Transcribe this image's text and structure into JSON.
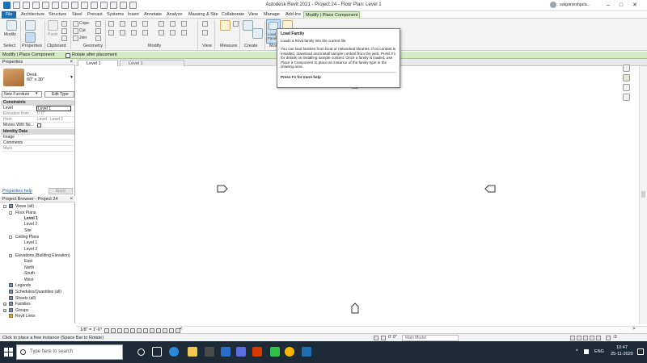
{
  "title_bar": {
    "app_title": "Autodesk Revit 2021 - Project 24 - Floor Plan: Level 1",
    "user": "saiganeshjala...",
    "window_buttons": [
      "minimize",
      "maximize",
      "close"
    ]
  },
  "menu_tabs": [
    "File",
    "Architecture",
    "Structure",
    "Steel",
    "Precast",
    "Systems",
    "Insert",
    "Annotate",
    "Analyze",
    "Massing & Site",
    "Collaborate",
    "View",
    "Manage",
    "Add-Ins",
    "Modify | Place Component"
  ],
  "ribbon": {
    "select": {
      "modify": "Modify",
      "group": "Select"
    },
    "properties": {
      "group": "Properties"
    },
    "clipboard": {
      "paste": "Paste",
      "group": "Clipboard"
    },
    "geometry": {
      "cope": "Cope",
      "cut": "Cut",
      "join": "Join",
      "group": "Geometry"
    },
    "modify_group": "Modify",
    "view_group": "View",
    "measure_group": "Measure",
    "create_group": "Create",
    "mode": {
      "load_family": "Load Family",
      "group": "Mode"
    }
  },
  "tooltip": {
    "title": "Load Family",
    "short": "Loads a Revit family into the current file.",
    "body": "You can load families from local or networked libraries. If no content is installed, download and install sample content from the web. Press F1 for details on installing sample content. Once a family is loaded, use Place a Component to place an instance of the family type in the drawing area.",
    "help": "Press F1 for more help"
  },
  "options_bar": {
    "context": "Modify | Place Component",
    "rotate_label": "Rotate after placement",
    "rotate_checked": false
  },
  "properties": {
    "header": "Properties",
    "type_name": "Desk",
    "type_size": "60\" x 30\"",
    "filter": "New Furniture",
    "edit_type": "Edit Type",
    "sections": {
      "constraints": "Constraints",
      "identity": "Identity Data"
    },
    "rows": {
      "level": {
        "key": "Level",
        "value": "Level 1"
      },
      "elevation": {
        "key": "Elevation from ...",
        "value": "0' 0\""
      },
      "host": {
        "key": "Host",
        "value": "Level : Level 1"
      },
      "moves": {
        "key": "Moves With Ne...",
        "checked": false
      },
      "image": {
        "key": "Image"
      },
      "comments": {
        "key": "Comments"
      },
      "mark": {
        "key": "Mark"
      }
    },
    "help_link": "Properties help",
    "apply": "Apply"
  },
  "project_browser": {
    "header": "Project Browser - Project 24",
    "items": [
      {
        "label": "Views (all)"
      },
      {
        "label": "Floor Plans"
      },
      {
        "label": "Level 1"
      },
      {
        "label": "Level 2"
      },
      {
        "label": "Site"
      },
      {
        "label": "Ceiling Plans"
      },
      {
        "label": "Level 1"
      },
      {
        "label": "Level 2"
      },
      {
        "label": "Elevations (Building Elevation)"
      },
      {
        "label": "East"
      },
      {
        "label": "North"
      },
      {
        "label": "South"
      },
      {
        "label": "West"
      },
      {
        "label": "Legends"
      },
      {
        "label": "Schedules/Quantities (all)"
      },
      {
        "label": "Sheets (all)"
      },
      {
        "label": "Families"
      },
      {
        "label": "Groups"
      },
      {
        "label": "Revit Links"
      }
    ]
  },
  "view_tabs": [
    "Level 1",
    "Level 1"
  ],
  "view_control": {
    "scale": "1/8\" = 1'-0\""
  },
  "status_bar": {
    "text": "Click to place a free instance (Space Bar to Rotate)",
    "model": "Main Model"
  },
  "taskbar": {
    "search_placeholder": "Type here to search",
    "language": "ENG",
    "time": "10:47",
    "date": "25-11-2020"
  },
  "colors": {
    "accent": "#1f6fb5",
    "context_tab": "#d4ecc6",
    "taskbar": "#1d2a38"
  }
}
